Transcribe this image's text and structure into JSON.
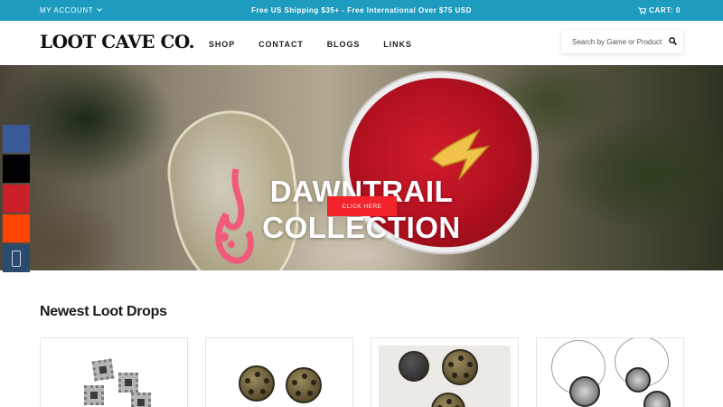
{
  "topbar": {
    "account_label": "MY ACCOUNT",
    "promo": "Free US Shipping $35+ - Free International Over $75 USD",
    "cart_label": "CART: 0"
  },
  "header": {
    "logo": "LOOT CAVE CO.",
    "nav": [
      "SHOP",
      "CONTACT",
      "BLOGS",
      "LINKS"
    ],
    "search_placeholder": "Search by Game or Product!"
  },
  "hero": {
    "title_line1": "DAWNTRAIL",
    "title_line2": "COLLECTION",
    "button_label": "CLICK HERE"
  },
  "share_bar": {
    "icons": [
      "facebook-icon",
      "x-icon",
      "pinterest-icon",
      "reddit-icon",
      "email-icon"
    ],
    "colors": [
      "#3b5998",
      "#000000",
      "#cb2027",
      "#ff4500",
      "#2a4b6e"
    ]
  },
  "products_section": {
    "title": "Newest Loot Drops",
    "products": [
      {
        "image": "square silver earrings"
      },
      {
        "image": "bronze revolver-cylinder gauges"
      },
      {
        "image": "bronze cylinder dangle earrings"
      },
      {
        "image": "silver disc pendant necklaces"
      }
    ]
  },
  "colors": {
    "topbar_bg": "#1d9cc0",
    "cta_red": "#f2232a"
  }
}
